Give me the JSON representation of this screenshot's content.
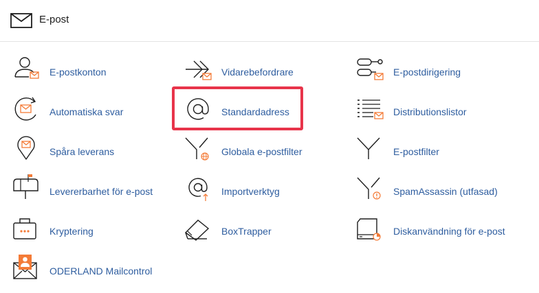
{
  "header": {
    "title": "E-post",
    "icon": "envelope-icon"
  },
  "colors": {
    "link": "#2e5d9f",
    "accent": "#f47b37",
    "highlight": "#e8344a",
    "icon_stroke": "#1d1d1d"
  },
  "items": [
    {
      "label": "E-postkonton",
      "icon": "email-accounts-icon"
    },
    {
      "label": "Vidarebefordrare",
      "icon": "forwarders-icon"
    },
    {
      "label": "E-postdirigering",
      "icon": "email-routing-icon"
    },
    {
      "label": "Automatiska svar",
      "icon": "autoresponders-icon"
    },
    {
      "label": "Standardadress",
      "icon": "default-address-icon",
      "highlighted": true
    },
    {
      "label": "Distributionslistor",
      "icon": "mailing-lists-icon"
    },
    {
      "label": "Spåra leverans",
      "icon": "track-delivery-icon"
    },
    {
      "label": "Globala e-postfilter",
      "icon": "global-email-filters-icon"
    },
    {
      "label": "E-postfilter",
      "icon": "email-filters-icon"
    },
    {
      "label": "Levererbarhet för e-post",
      "icon": "email-deliverability-icon"
    },
    {
      "label": "Importverktyg",
      "icon": "import-tool-icon"
    },
    {
      "label": "SpamAssassin (utfasad)",
      "icon": "spamassassin-icon"
    },
    {
      "label": "Kryptering",
      "icon": "encryption-icon"
    },
    {
      "label": "BoxTrapper",
      "icon": "boxtrapper-icon"
    },
    {
      "label": "Diskanvändning för e-post",
      "icon": "email-disk-usage-icon"
    },
    {
      "label": "ODERLAND Mailcontrol",
      "icon": "oderland-mailcontrol-icon"
    }
  ]
}
